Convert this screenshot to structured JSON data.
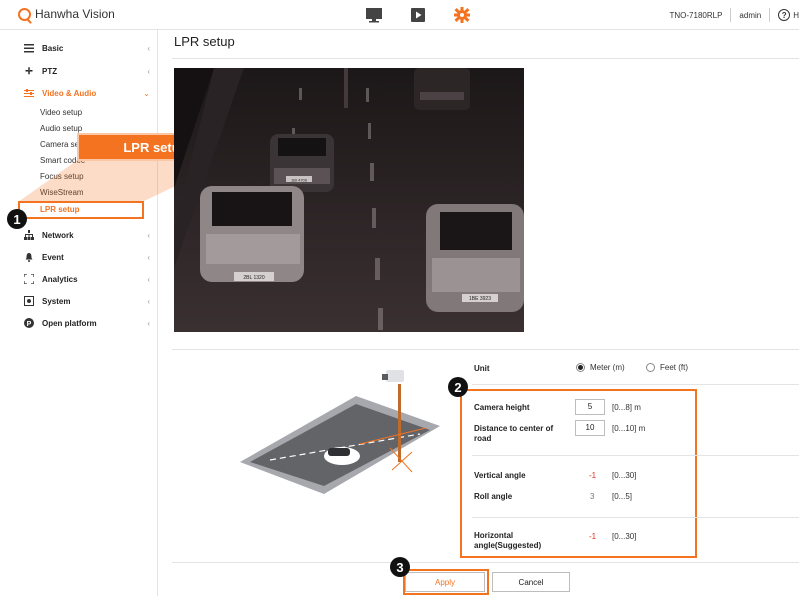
{
  "header": {
    "logo_text": "Hanwha Vision",
    "icons": [
      "monitor-icon",
      "play-icon",
      "gear-icon"
    ],
    "model": "TNO-7180RLP",
    "user": "admin",
    "help_text": "H"
  },
  "sidebar": {
    "items": [
      {
        "label": "Basic",
        "icon": "list-icon"
      },
      {
        "label": "PTZ",
        "icon": "move-icon"
      },
      {
        "label": "Video & Audio",
        "icon": "sliders-icon"
      },
      {
        "label": "Network",
        "icon": "network-icon"
      },
      {
        "label": "Event",
        "icon": "bell-icon"
      },
      {
        "label": "Analytics",
        "icon": "frame-icon"
      },
      {
        "label": "System",
        "icon": "system-icon"
      },
      {
        "label": "Open platform",
        "icon": "platform-icon"
      }
    ],
    "sub_items": [
      "Video setup",
      "Audio setup",
      "Camera set",
      "Smart codec",
      "Focus setup",
      "WiseStream",
      "LPR setup"
    ],
    "chevron": "‹"
  },
  "banner": {
    "label": "LPR setup"
  },
  "callouts": [
    "1",
    "2",
    "3"
  ],
  "page": {
    "title": "LPR setup",
    "plate_text": [
      "1BI 4709",
      "1BE 3923",
      "2BL 1320"
    ],
    "unit": {
      "label": "Unit",
      "options": [
        "Meter (m)",
        "Feet (ft)"
      ],
      "selected": "Meter (m)"
    },
    "camera_height": {
      "label": "Camera height",
      "value": "5",
      "range": "[0...8] m"
    },
    "distance": {
      "label": "Distance to center of road",
      "value": "10",
      "range": "[0...10] m"
    },
    "vertical_angle": {
      "label": "Vertical angle",
      "value": "-1",
      "range": "[0...30]"
    },
    "roll_angle": {
      "label": "Roll angle",
      "value": "3",
      "range": "[0...5]"
    },
    "horizontal_angle": {
      "label": "Horizontal angle(Suggested)",
      "value": "-1",
      "range": "[0...30]"
    },
    "apply_label": "Apply",
    "cancel_label": "Cancel"
  },
  "colors": {
    "accent": "#f37321",
    "negative": "#e0301e"
  }
}
